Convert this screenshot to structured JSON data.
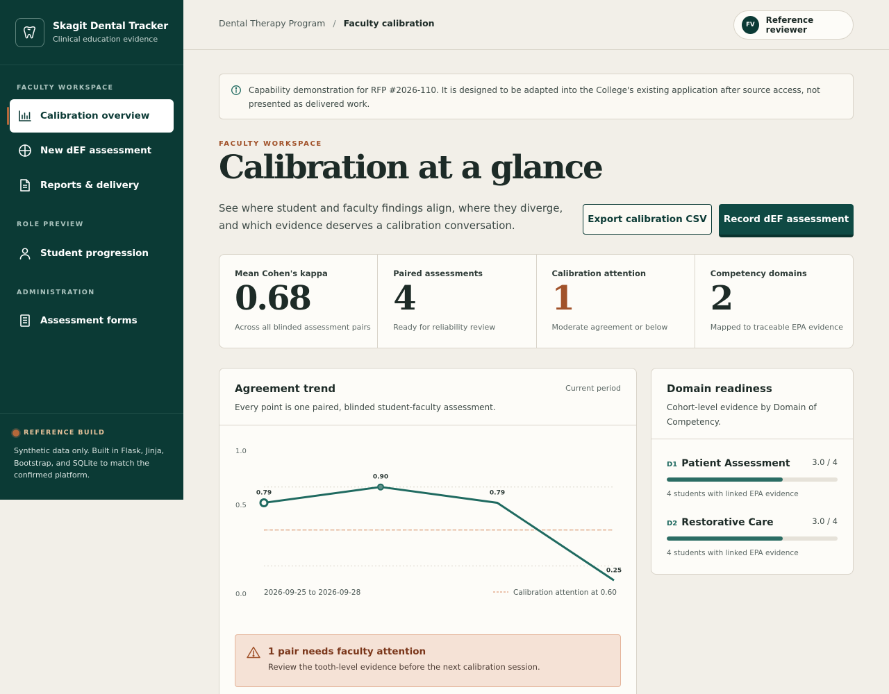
{
  "brand": {
    "title": "Skagit Dental Tracker",
    "subtitle": "Clinical education evidence"
  },
  "sidebar": {
    "section_faculty": "FACULTY WORKSPACE",
    "section_role": "ROLE PREVIEW",
    "section_admin": "ADMINISTRATION",
    "items": [
      {
        "label": "Calibration overview",
        "icon": "bar-chart-icon",
        "active": true
      },
      {
        "label": "New dEF assessment",
        "icon": "plus-circle-icon"
      },
      {
        "label": "Reports & delivery",
        "icon": "document-icon"
      },
      {
        "label": "Student progression",
        "icon": "user-icon"
      },
      {
        "label": "Assessment forms",
        "icon": "form-icon"
      }
    ],
    "footer_tag": "REFERENCE BUILD",
    "footer_text": "Synthetic data only. Built in Flask, Jinja, Bootstrap, and SQLite to match the confirmed platform."
  },
  "breadcrumb": {
    "parent": "Dental Therapy Program",
    "separator": "/",
    "current": "Faculty calibration"
  },
  "reviewer": {
    "initials": "FV",
    "label": "Reference reviewer"
  },
  "notice": "Capability demonstration for RFP #2026-110. It is designed to be adapted into the College's existing application after source access, not presented as delivered work.",
  "page": {
    "eyebrow": "FACULTY WORKSPACE",
    "title": "Calibration at a glance",
    "lede": "See where student and faculty findings align, where they diverge, and which evidence deserves a calibration conversation.",
    "export_label": "Export calibration CSV",
    "record_label": "Record dEF assessment"
  },
  "stats": [
    {
      "label": "Mean Cohen's kappa",
      "value": "0.68",
      "note": "Across all blinded assessment pairs"
    },
    {
      "label": "Paired assessments",
      "value": "4",
      "note": "Ready for reliability review"
    },
    {
      "label": "Calibration attention",
      "value": "1",
      "note": "Moderate agreement or below"
    },
    {
      "label": "Competency domains",
      "value": "2",
      "note": "Mapped to traceable EPA evidence"
    }
  ],
  "trend": {
    "title": "Agreement trend",
    "subtitle": "Every point is one paired, blinded student-faculty assessment.",
    "period": "Current period",
    "alert_title": "1 pair needs faculty attention",
    "alert_text": "Review the tooth-level evidence before the next calibration session."
  },
  "chart_data": {
    "type": "line",
    "y_ticks": [
      "1.0",
      "0.5",
      "0.0"
    ],
    "ylim": [
      0,
      1
    ],
    "x_range_label": "2026-09-25 to 2026-09-28",
    "values": [
      0.79,
      0.9,
      0.79,
      0.25
    ],
    "point_labels": [
      "0.79",
      "0.90",
      "0.79",
      "0.25"
    ],
    "threshold": 0.6,
    "threshold_label": "Calibration attention at 0.60",
    "colors": {
      "line": "#1f6a60",
      "threshold": "#d98a5f"
    }
  },
  "domains": {
    "title": "Domain readiness",
    "subtitle": "Cohort-level evidence by Domain of Competency.",
    "items": [
      {
        "code": "D1",
        "name": "Patient Assessment",
        "score": "3.0 / 4",
        "level": 0.68,
        "note": "4 students with linked EPA evidence"
      },
      {
        "code": "D2",
        "name": "Restorative Care",
        "score": "3.0 / 4",
        "level": 0.68,
        "note": "4 students with linked EPA evidence"
      }
    ]
  }
}
